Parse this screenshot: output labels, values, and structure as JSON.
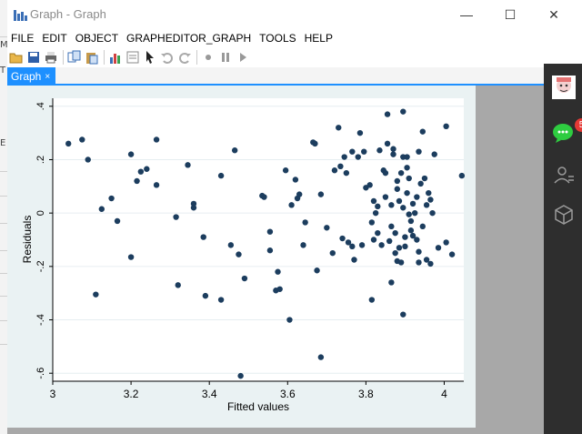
{
  "window": {
    "title": "Graph - Graph"
  },
  "window_controls": {
    "minimize": "—",
    "maximize": "☐",
    "close": "✕"
  },
  "menu": [
    "FILE",
    "EDIT",
    "OBJECT",
    "GRAPHEDITOR_GRAPH",
    "TOOLS",
    "HELP"
  ],
  "toolbar": {
    "icons": [
      "open-icon",
      "save-icon",
      "print-icon",
      "copy-icon",
      "paste-icon",
      "chart-icon",
      "properties-icon",
      "pointer-icon",
      "undo-icon",
      "redo-icon",
      "record-icon",
      "pause-icon",
      "play-icon"
    ]
  },
  "tab": {
    "label": "Graph",
    "close": "×"
  },
  "background_window": {
    "tags": [
      "E",
      "T",
      "M"
    ]
  },
  "dock": {
    "badge_count": "5",
    "icons": [
      "avatar",
      "chat-icon",
      "contacts-icon",
      "cube-icon"
    ]
  },
  "colors": {
    "accent": "#1e90ff",
    "marker": "#1c3d5e",
    "plot_bg": "#eaf2f3",
    "dock_bg": "#2e2e2e",
    "badge": "#e53935"
  },
  "chart_data": {
    "type": "scatter",
    "xlabel": "Fitted values",
    "ylabel": "Residuals",
    "xlim": [
      3,
      4.05
    ],
    "ylim": [
      -0.63,
      0.43
    ],
    "xticks": [
      "3",
      "3.2",
      "3.4",
      "3.6",
      "3.8",
      "4"
    ],
    "yticks": [
      "-.6",
      "-.4",
      "-.2",
      "0",
      ".2",
      ".4"
    ],
    "grid": true,
    "points": [
      [
        3.04,
        0.26
      ],
      [
        3.075,
        0.275
      ],
      [
        3.09,
        0.2
      ],
      [
        3.11,
        -0.305
      ],
      [
        3.125,
        0.015
      ],
      [
        3.15,
        0.055
      ],
      [
        3.165,
        -0.03
      ],
      [
        3.2,
        -0.165
      ],
      [
        3.2,
        0.22
      ],
      [
        3.215,
        0.12
      ],
      [
        3.225,
        0.155
      ],
      [
        3.24,
        0.165
      ],
      [
        3.265,
        0.275
      ],
      [
        3.265,
        0.105
      ],
      [
        3.315,
        -0.015
      ],
      [
        3.32,
        -0.27
      ],
      [
        3.345,
        0.18
      ],
      [
        3.36,
        0.035
      ],
      [
        3.36,
        0.02
      ],
      [
        3.385,
        -0.09
      ],
      [
        3.39,
        -0.31
      ],
      [
        3.43,
        -0.325
      ],
      [
        3.43,
        0.14
      ],
      [
        3.455,
        -0.12
      ],
      [
        3.465,
        0.235
      ],
      [
        3.475,
        -0.155
      ],
      [
        3.48,
        -0.61
      ],
      [
        3.49,
        -0.245
      ],
      [
        3.535,
        0.065
      ],
      [
        3.54,
        0.06
      ],
      [
        3.555,
        -0.14
      ],
      [
        3.555,
        -0.07
      ],
      [
        3.57,
        -0.29
      ],
      [
        3.575,
        -0.22
      ],
      [
        3.58,
        -0.285
      ],
      [
        3.595,
        0.16
      ],
      [
        3.605,
        -0.4
      ],
      [
        3.61,
        0.03
      ],
      [
        3.62,
        0.125
      ],
      [
        3.625,
        0.055
      ],
      [
        3.63,
        0.07
      ],
      [
        3.64,
        -0.12
      ],
      [
        3.645,
        -0.035
      ],
      [
        3.665,
        0.265
      ],
      [
        3.67,
        0.26
      ],
      [
        3.675,
        -0.215
      ],
      [
        3.685,
        0.07
      ],
      [
        3.685,
        -0.54
      ],
      [
        3.7,
        -0.055
      ],
      [
        3.715,
        -0.15
      ],
      [
        3.72,
        0.16
      ],
      [
        3.73,
        0.32
      ],
      [
        3.735,
        0.175
      ],
      [
        3.74,
        -0.095
      ],
      [
        3.745,
        0.21
      ],
      [
        3.75,
        0.15
      ],
      [
        3.755,
        -0.11
      ],
      [
        3.765,
        0.23
      ],
      [
        3.765,
        -0.125
      ],
      [
        3.77,
        -0.175
      ],
      [
        3.78,
        0.21
      ],
      [
        3.785,
        0.3
      ],
      [
        3.79,
        -0.12
      ],
      [
        3.795,
        0.23
      ],
      [
        3.8,
        0.095
      ],
      [
        3.81,
        0.105
      ],
      [
        3.815,
        -0.035
      ],
      [
        3.815,
        -0.325
      ],
      [
        3.82,
        0.045
      ],
      [
        3.82,
        -0.1
      ],
      [
        3.825,
        0.0
      ],
      [
        3.83,
        0.025
      ],
      [
        3.83,
        -0.075
      ],
      [
        3.835,
        0.235
      ],
      [
        3.84,
        -0.12
      ],
      [
        3.845,
        0.16
      ],
      [
        3.85,
        0.15
      ],
      [
        3.85,
        0.06
      ],
      [
        3.855,
        0.26
      ],
      [
        3.855,
        0.37
      ],
      [
        3.86,
        -0.105
      ],
      [
        3.865,
        -0.26
      ],
      [
        3.865,
        0.03
      ],
      [
        3.865,
        -0.05
      ],
      [
        3.87,
        0.22
      ],
      [
        3.87,
        0.24
      ],
      [
        3.875,
        -0.15
      ],
      [
        3.875,
        -0.075
      ],
      [
        3.88,
        0.12
      ],
      [
        3.88,
        0.09
      ],
      [
        3.88,
        -0.18
      ],
      [
        3.885,
        0.045
      ],
      [
        3.885,
        -0.13
      ],
      [
        3.89,
        -0.185
      ],
      [
        3.89,
        0.15
      ],
      [
        3.895,
        0.02
      ],
      [
        3.895,
        0.21
      ],
      [
        3.895,
        0.38
      ],
      [
        3.895,
        -0.38
      ],
      [
        3.9,
        -0.09
      ],
      [
        3.9,
        -0.125
      ],
      [
        3.905,
        0.17
      ],
      [
        3.905,
        0.21
      ],
      [
        3.905,
        0.075
      ],
      [
        3.91,
        -0.005
      ],
      [
        3.91,
        0.13
      ],
      [
        3.915,
        -0.03
      ],
      [
        3.915,
        -0.065
      ],
      [
        3.92,
        -0.085
      ],
      [
        3.92,
        0.035
      ],
      [
        3.925,
        0.0
      ],
      [
        3.93,
        0.06
      ],
      [
        3.93,
        -0.1
      ],
      [
        3.935,
        0.23
      ],
      [
        3.935,
        -0.185
      ],
      [
        3.935,
        -0.145
      ],
      [
        3.94,
        0.11
      ],
      [
        3.945,
        0.305
      ],
      [
        3.945,
        -0.05
      ],
      [
        3.95,
        0.13
      ],
      [
        3.955,
        0.03
      ],
      [
        3.955,
        -0.175
      ],
      [
        3.96,
        0.075
      ],
      [
        3.965,
        0.05
      ],
      [
        3.965,
        -0.19
      ],
      [
        3.97,
        0.0
      ],
      [
        3.975,
        0.22
      ],
      [
        3.985,
        -0.13
      ],
      [
        4.005,
        0.325
      ],
      [
        4.005,
        -0.11
      ],
      [
        4.02,
        -0.155
      ],
      [
        4.045,
        0.14
      ]
    ]
  }
}
